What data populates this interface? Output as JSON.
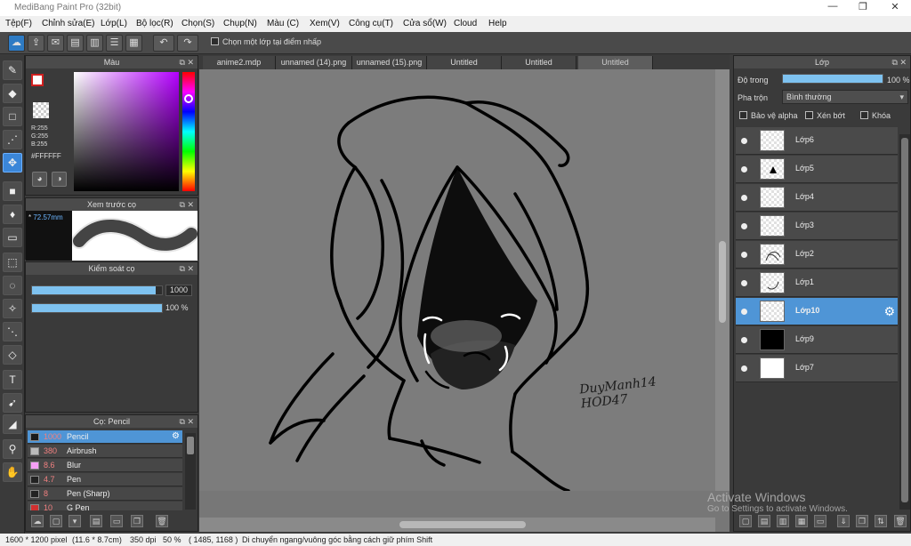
{
  "window": {
    "title": "MediBang Paint Pro (32bit)",
    "minimize": "—",
    "restore": "❐",
    "close": "✕"
  },
  "menu": [
    "Tệp(F)",
    "Chỉnh sửa(E)",
    "Lớp(L)",
    "Bộ lọc(R)",
    "Chọn(S)",
    "Chụp(N)",
    "Màu (C)",
    "Xem(V)",
    "Công cụ(T)",
    "Cửa sổ(W)",
    "Cloud",
    "Help"
  ],
  "toolbar": {
    "select_layer_label": "Chọn một lớp tại điểm nhấp"
  },
  "color_panel": {
    "title": "Màu",
    "r": "R:255",
    "g": "G:255",
    "b": "B:255",
    "hex": "#FFFFFF"
  },
  "brush_preview": {
    "title": "Xem trước cọ",
    "size": "72.57mm"
  },
  "brush_control": {
    "title": "Kiểm soát cọ",
    "size_value": "1000",
    "opacity_value": "100 %",
    "size_fill": 0.95,
    "opacity_fill": 1.0
  },
  "brush_panel": {
    "title": "Cọ: Pencil",
    "items": [
      {
        "size": "1000",
        "name": "Pencil",
        "color": "#1a1a1a",
        "selected": true
      },
      {
        "size": "380",
        "name": "Airbrush",
        "color": "#bbbbbb",
        "selected": false
      },
      {
        "size": "8.6",
        "name": "Blur",
        "color": "#f5a0f5",
        "selected": false
      },
      {
        "size": "4.7",
        "name": "Pen",
        "color": "#222222",
        "selected": false
      },
      {
        "size": "8",
        "name": "Pen (Sharp)",
        "color": "#222222",
        "selected": false
      },
      {
        "size": "10",
        "name": "G Pen",
        "color": "#d03030",
        "selected": false
      }
    ]
  },
  "tabs": [
    {
      "label": "anime2.mdp",
      "active": false
    },
    {
      "label": "unnamed (14).png",
      "active": false
    },
    {
      "label": "unnamed (15).png",
      "active": false
    },
    {
      "label": "Untitled",
      "active": false
    },
    {
      "label": "Untitled",
      "active": false
    },
    {
      "label": "Untitled",
      "active": true
    }
  ],
  "canvas": {
    "signature_line1": "DuyManh14",
    "signature_line2": "HOD47"
  },
  "layer_panel": {
    "title": "Lớp",
    "opacity_label": "Độ trong",
    "opacity_value": "100 %",
    "blend_label": "Pha trộn",
    "blend_value": "Bình thường",
    "protect_alpha": "Bảo vệ alpha",
    "clipping": "Xén bớt",
    "lock": "Khóa",
    "layers": [
      {
        "name": "Lớp6",
        "selected": false,
        "thumb": "empty"
      },
      {
        "name": "Lớp5",
        "selected": false,
        "thumb": "mark"
      },
      {
        "name": "Lớp4",
        "selected": false,
        "thumb": "empty"
      },
      {
        "name": "Lớp3",
        "selected": false,
        "thumb": "empty"
      },
      {
        "name": "Lớp2",
        "selected": false,
        "thumb": "sketch"
      },
      {
        "name": "Lớp1",
        "selected": false,
        "thumb": "sketch"
      },
      {
        "name": "Lớp10",
        "selected": true,
        "thumb": "empty"
      },
      {
        "name": "Lớp9",
        "selected": false,
        "thumb": "black"
      },
      {
        "name": "Lớp7",
        "selected": false,
        "thumb": "white"
      }
    ]
  },
  "watermark": {
    "line1": "Activate Windows",
    "line2": "Go to Settings to activate Windows."
  },
  "status": {
    "size": "1600 * 1200 pixel",
    "physical": "(11.6 * 8.7cm)",
    "dpi": "350 dpi",
    "zoom": "50 %",
    "coords": "( 1485, 1168 )",
    "hint": "Di chuyển ngang/vuông góc bằng cách giữ phím Shift"
  }
}
